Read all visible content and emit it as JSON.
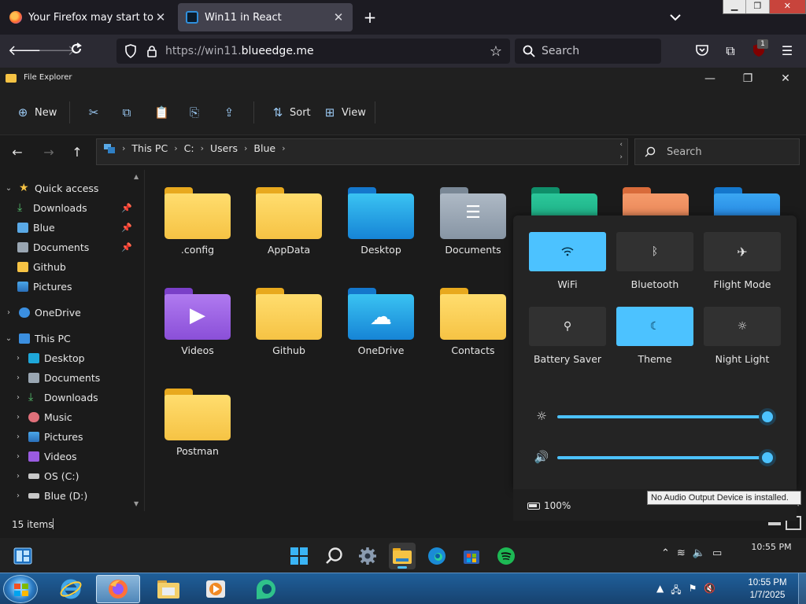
{
  "browser": {
    "tabs": [
      {
        "title": "Your Firefox may start to have p",
        "close": "✕"
      },
      {
        "title": "Win11 in React",
        "close": "✕"
      }
    ],
    "new_tab": "+",
    "url_prefix": "https://win11.",
    "url_domain": "blueedge.me",
    "search_placeholder": "Search",
    "ublock_count": "1"
  },
  "file_explorer": {
    "title": "File Explorer",
    "toolbar": {
      "new": "New",
      "sort": "Sort",
      "view": "View"
    },
    "breadcrumb": [
      "This PC",
      "C:",
      "Users",
      "Blue"
    ],
    "search_placeholder": "Search",
    "sidebar": {
      "quick_access": "Quick access",
      "pinned": [
        "Downloads",
        "Blue",
        "Documents",
        "Github",
        "Pictures"
      ],
      "onedrive": "OneDrive",
      "this_pc": "This PC",
      "pc_items": [
        "Desktop",
        "Documents",
        "Downloads",
        "Music",
        "Pictures",
        "Videos",
        "OS (C:)",
        "Blue (D:)"
      ]
    },
    "folders": [
      ".config",
      "AppData",
      "Desktop",
      "Documents",
      "Videos",
      "Github",
      "OneDrive",
      "Contacts",
      "Postman"
    ],
    "status": "15 items"
  },
  "quick_settings": {
    "tiles": [
      {
        "label": "WiFi",
        "on": true
      },
      {
        "label": "Bluetooth",
        "on": false
      },
      {
        "label": "Flight Mode",
        "on": false
      },
      {
        "label": "Battery Saver",
        "on": false
      },
      {
        "label": "Theme",
        "on": true
      },
      {
        "label": "Night Light",
        "on": false
      }
    ],
    "brightness": 1.0,
    "volume": 1.0,
    "battery": "100%"
  },
  "w11_taskbar": {
    "time": "10:55 PM",
    "tooltip": "No Audio Output Device is installed."
  },
  "w7_taskbar": {
    "time": "10:55 PM",
    "date": "1/7/2025"
  },
  "colors": {
    "accent": "#4cc2ff",
    "folder_yellow": "#f6c344"
  }
}
